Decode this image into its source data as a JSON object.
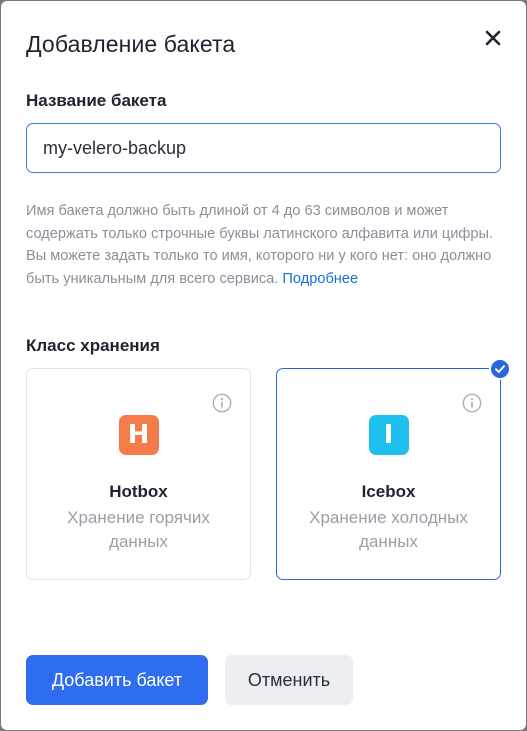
{
  "dialog": {
    "title": "Добавление бакета"
  },
  "bucket_name": {
    "label": "Название бакета",
    "value": "my-velero-backup",
    "hint": "Имя бакета должно быть длиной от 4 до 63 символов и может содержать только строчные буквы латинского алфавита или цифры. Вы можете задать только то имя, которого ни у кого нет: оно должно быть уникальным для всего сервиса.",
    "hint_link": "Подробнее"
  },
  "storage_class": {
    "label": "Класс хранения",
    "options": [
      {
        "icon_letter": "H",
        "icon_color": "#f47c4a",
        "name": "Hotbox",
        "description": "Хранение горячих данных",
        "selected": false
      },
      {
        "icon_letter": "I",
        "icon_color": "#1ec1ee",
        "name": "Icebox",
        "description": "Хранение холодных данных",
        "selected": true
      }
    ]
  },
  "actions": {
    "submit_label": "Добавить бакет",
    "cancel_label": "Отменить"
  },
  "colors": {
    "accent": "#2f6df0",
    "hotbox": "#f47c4a",
    "icebox": "#1ec1ee"
  }
}
